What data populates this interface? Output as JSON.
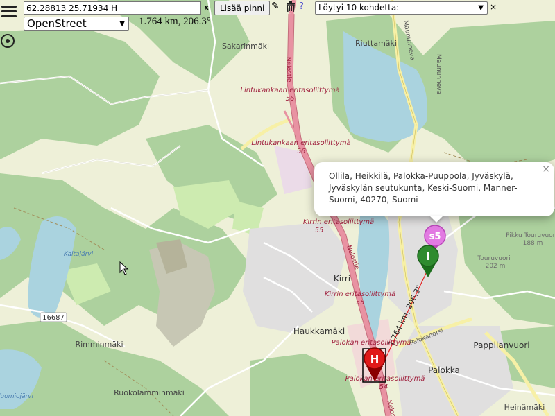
{
  "toolbar": {
    "coordinate_value": "62.28813 25.71934 H",
    "clear_label": "x",
    "add_pin_label": "Lisää pinni",
    "help_label": "?",
    "results_label": "Löytyi 10 kohdetta:",
    "results_close_label": "×",
    "layer_label": "OpenStreet",
    "distance_readout": "1.764 km, 206.3°"
  },
  "popup": {
    "text": "Ollila, Heikkilä, Palokka-Puuppola, Jyväskylä, Jyväskylän seutukunta, Keski-Suomi, Manner-Suomi, 40270, Suomi",
    "close_label": "×"
  },
  "markers": {
    "h": "H",
    "i": "I",
    "s5": "s5"
  },
  "map": {
    "line_label": "1.764 km, 206.3°",
    "places": {
      "sakarinmaki": "Sakarinmäki",
      "riuttamaki": "Riuttamäki",
      "kirri": "Kirri",
      "haukkamaki": "Haukkamäki",
      "rimminmaki": "Rimminmäki",
      "ruokolamminmaki": "Ruokolamminmäki",
      "pappilanvuori": "Pappilanvuori",
      "palokka": "Palokka",
      "heinamaki": "Heinämäki",
      "pikku_touruvuori": "Pikku Touruvuori",
      "pikku_touruvuori_ele": "188 m",
      "touruvuori": "Touruvuori",
      "touruvuori_ele": "202 m",
      "kaitajarvi": "Kaitajärvi",
      "tuomiojarvi": "Tuomiojärvi"
    },
    "junctions": {
      "lintukankaan_1": "Lintukankaan eritasoliittymä",
      "lintukankaan_1_num": "56",
      "lintukankaan_2": "Lintukankaan eritasoliittymä",
      "lintukankaan_2_num": "56",
      "kirrin_1": "Kirrin eritasoliittymä",
      "kirrin_1_num": "55",
      "kirrin_2": "Kirrin eritasoliittymä",
      "kirrin_2_num": "55",
      "palokan_1": "Palokan eritasoliittymä",
      "palokan_2": "Palokan eritasoliittymä",
      "palokan_2_num": "54"
    },
    "roads": {
      "nelostie_1": "Nelostie",
      "nelostie_2": "Nelostie",
      "nelostie_3": "Nelostie",
      "maununneva_1": "Maununneva",
      "maununneva_2": "Maununneva",
      "palokanorsi": "Palokanorsi",
      "road_shield": "16687"
    }
  }
}
